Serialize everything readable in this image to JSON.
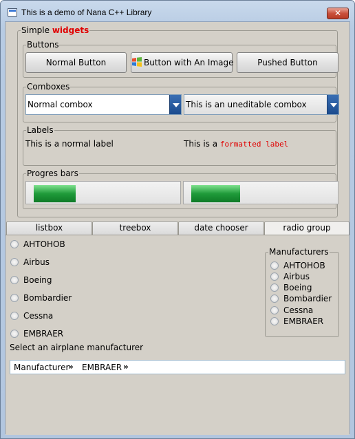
{
  "window": {
    "title": "This is a demo of Nana C++ Library",
    "close_label": "✕"
  },
  "simple_widgets": {
    "title_prefix": "Simple",
    "title_highlight": "widgets"
  },
  "buttons_group": {
    "title": "Buttons",
    "normal": "Normal Button",
    "image": "Button with An Image",
    "pushed": "Pushed Button"
  },
  "combos_group": {
    "title": "Comboxes",
    "normal": "Normal combox",
    "uneditable": "This is an uneditable combox"
  },
  "labels_group": {
    "title": "Labels",
    "normal": "This is a normal label",
    "formatted_prefix": "This is a",
    "formatted_highlight": "formatted label"
  },
  "progress_group": {
    "title": "Progres bars",
    "bars": [
      {
        "value": 0.3
      },
      {
        "value": 0.35
      }
    ]
  },
  "tabs": [
    "listbox",
    "treebox",
    "date chooser",
    "radio group"
  ],
  "radio_list": [
    "AHTOHOB",
    "Airbus",
    "Boeing",
    "Bombardier",
    "Cessna",
    "EMBRAER"
  ],
  "manufacturers_box": {
    "title": "Manufacturers",
    "items": [
      "AHTOHOB",
      "Airbus",
      "Boeing",
      "Bombardier",
      "Cessna",
      "EMBRAER"
    ]
  },
  "prompt": "Select an airplane manufacturer",
  "breadcrumb": {
    "items": [
      "Manufacturer",
      "EMBRAER"
    ],
    "separator": "»"
  },
  "colors": {
    "accent_red": "#e00000",
    "progress_green": "#1f9b3a",
    "combo_arrow": "#1b4b8e"
  }
}
